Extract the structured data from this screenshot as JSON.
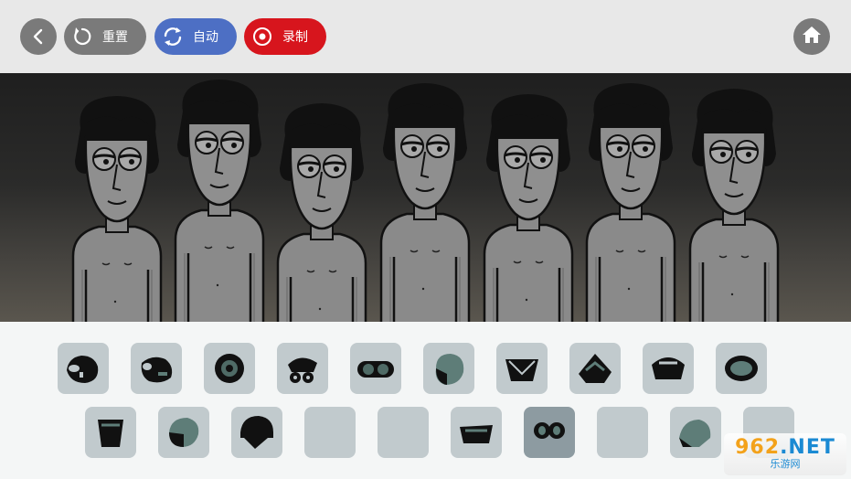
{
  "toolbar": {
    "back_icon": "chevron-left-icon",
    "reset_label": "重置",
    "reset_icon": "refresh-icon",
    "auto_label": "自动",
    "auto_icon": "sync-icon",
    "record_label": "录制",
    "record_icon": "record-icon",
    "home_icon": "home-icon",
    "colors": {
      "gray": "#7a7a7a",
      "auto": "#4d6fc4",
      "record": "#d7151d"
    }
  },
  "stage": {
    "character_count": 7,
    "characters": [
      "character-1",
      "character-2",
      "character-3",
      "character-4",
      "character-5",
      "character-6",
      "character-7"
    ]
  },
  "tray": {
    "row1": [
      {
        "icon": "sound-icon-1",
        "filled": true
      },
      {
        "icon": "sound-icon-2",
        "filled": true
      },
      {
        "icon": "sound-icon-3",
        "filled": true
      },
      {
        "icon": "sound-icon-4",
        "filled": true
      },
      {
        "icon": "sound-icon-5",
        "filled": true
      },
      {
        "icon": "sound-icon-6",
        "filled": true
      },
      {
        "icon": "sound-icon-7",
        "filled": true
      },
      {
        "icon": "sound-icon-8",
        "filled": true
      },
      {
        "icon": "sound-icon-9",
        "filled": true
      },
      {
        "icon": "sound-icon-10",
        "filled": true
      }
    ],
    "row2": [
      {
        "icon": "sound-icon-11",
        "filled": true
      },
      {
        "icon": "sound-icon-12",
        "filled": true
      },
      {
        "icon": "sound-icon-13",
        "filled": true
      },
      {
        "icon": "empty",
        "filled": false
      },
      {
        "icon": "empty",
        "filled": false
      },
      {
        "icon": "sound-icon-14",
        "filled": true
      },
      {
        "icon": "sound-icon-15",
        "filled": true,
        "active": true
      },
      {
        "icon": "empty",
        "filled": false
      },
      {
        "icon": "sound-icon-16",
        "filled": true
      },
      {
        "icon": "empty",
        "filled": false
      }
    ]
  },
  "watermark": {
    "prefix": "962",
    "suffix": ".NET",
    "sub": "乐游网"
  }
}
